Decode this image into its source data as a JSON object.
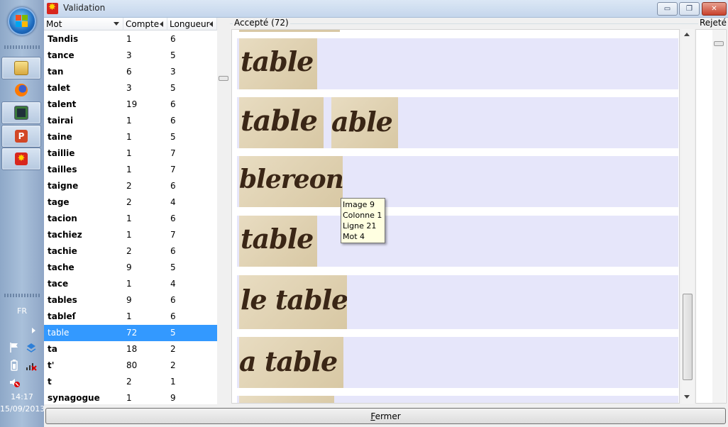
{
  "window": {
    "title": "Validation",
    "minimize_glyph": "▭",
    "maximize_glyph": "❐",
    "close_glyph": "✕"
  },
  "taskbar": {
    "language": "FR",
    "time": "14:17",
    "date": "15/09/2013",
    "apps": [
      "folder-icon",
      "firefox-icon",
      "terminal-icon",
      "powerpoint-icon",
      "validation-app-icon"
    ],
    "tray_icons": [
      "flag-icon",
      "network-icon",
      "battery-icon",
      "signal-icon",
      "volume-muted-icon"
    ]
  },
  "word_list": {
    "columns": [
      "Mot",
      "Compte",
      "Longueur"
    ],
    "rows": [
      {
        "mot": "Tandis",
        "compte": "1",
        "longueur": "6"
      },
      {
        "mot": "tance",
        "compte": "3",
        "longueur": "5"
      },
      {
        "mot": "tan",
        "compte": "6",
        "longueur": "3"
      },
      {
        "mot": "talet",
        "compte": "3",
        "longueur": "5"
      },
      {
        "mot": "talent",
        "compte": "19",
        "longueur": "6"
      },
      {
        "mot": "tairai",
        "compte": "1",
        "longueur": "6"
      },
      {
        "mot": "taine",
        "compte": "1",
        "longueur": "5"
      },
      {
        "mot": "taillie",
        "compte": "1",
        "longueur": "7"
      },
      {
        "mot": "tailles",
        "compte": "1",
        "longueur": "7"
      },
      {
        "mot": "taigne",
        "compte": "2",
        "longueur": "6"
      },
      {
        "mot": "tage",
        "compte": "2",
        "longueur": "4"
      },
      {
        "mot": "tacion",
        "compte": "1",
        "longueur": "6"
      },
      {
        "mot": "tachiez",
        "compte": "1",
        "longueur": "7"
      },
      {
        "mot": "tachie",
        "compte": "2",
        "longueur": "6"
      },
      {
        "mot": "tache",
        "compte": "9",
        "longueur": "5"
      },
      {
        "mot": "tace",
        "compte": "1",
        "longueur": "4"
      },
      {
        "mot": "tables",
        "compte": "9",
        "longueur": "6"
      },
      {
        "mot": "tableſ",
        "compte": "1",
        "longueur": "6"
      },
      {
        "mot": "table",
        "compte": "72",
        "longueur": "5",
        "selected": true
      },
      {
        "mot": "ta",
        "compte": "18",
        "longueur": "2"
      },
      {
        "mot": "t'",
        "compte": "80",
        "longueur": "2"
      },
      {
        "mot": "t",
        "compte": "2",
        "longueur": "1"
      },
      {
        "mot": "synagogue",
        "compte": "1",
        "longueur": "9"
      }
    ]
  },
  "accepted": {
    "caption": "Accepté (72)",
    "thumbnails": [
      {
        "text": "table"
      },
      {
        "text": "table"
      },
      {
        "text": "able"
      },
      {
        "text": "blereon"
      },
      {
        "text": "table"
      },
      {
        "text": "le table"
      },
      {
        "text": "a table"
      }
    ]
  },
  "tooltip": {
    "lines": [
      "Image 9",
      "Colonne 1",
      "Ligne 21",
      "Mot 4"
    ]
  },
  "rejected": {
    "caption": "Rejeté"
  },
  "footer": {
    "close_first": "F",
    "close_rest": "ermer"
  },
  "colors": {
    "selection": "#3399ff",
    "band": "#e6e6fa",
    "tooltip_bg": "#ffffe1"
  }
}
